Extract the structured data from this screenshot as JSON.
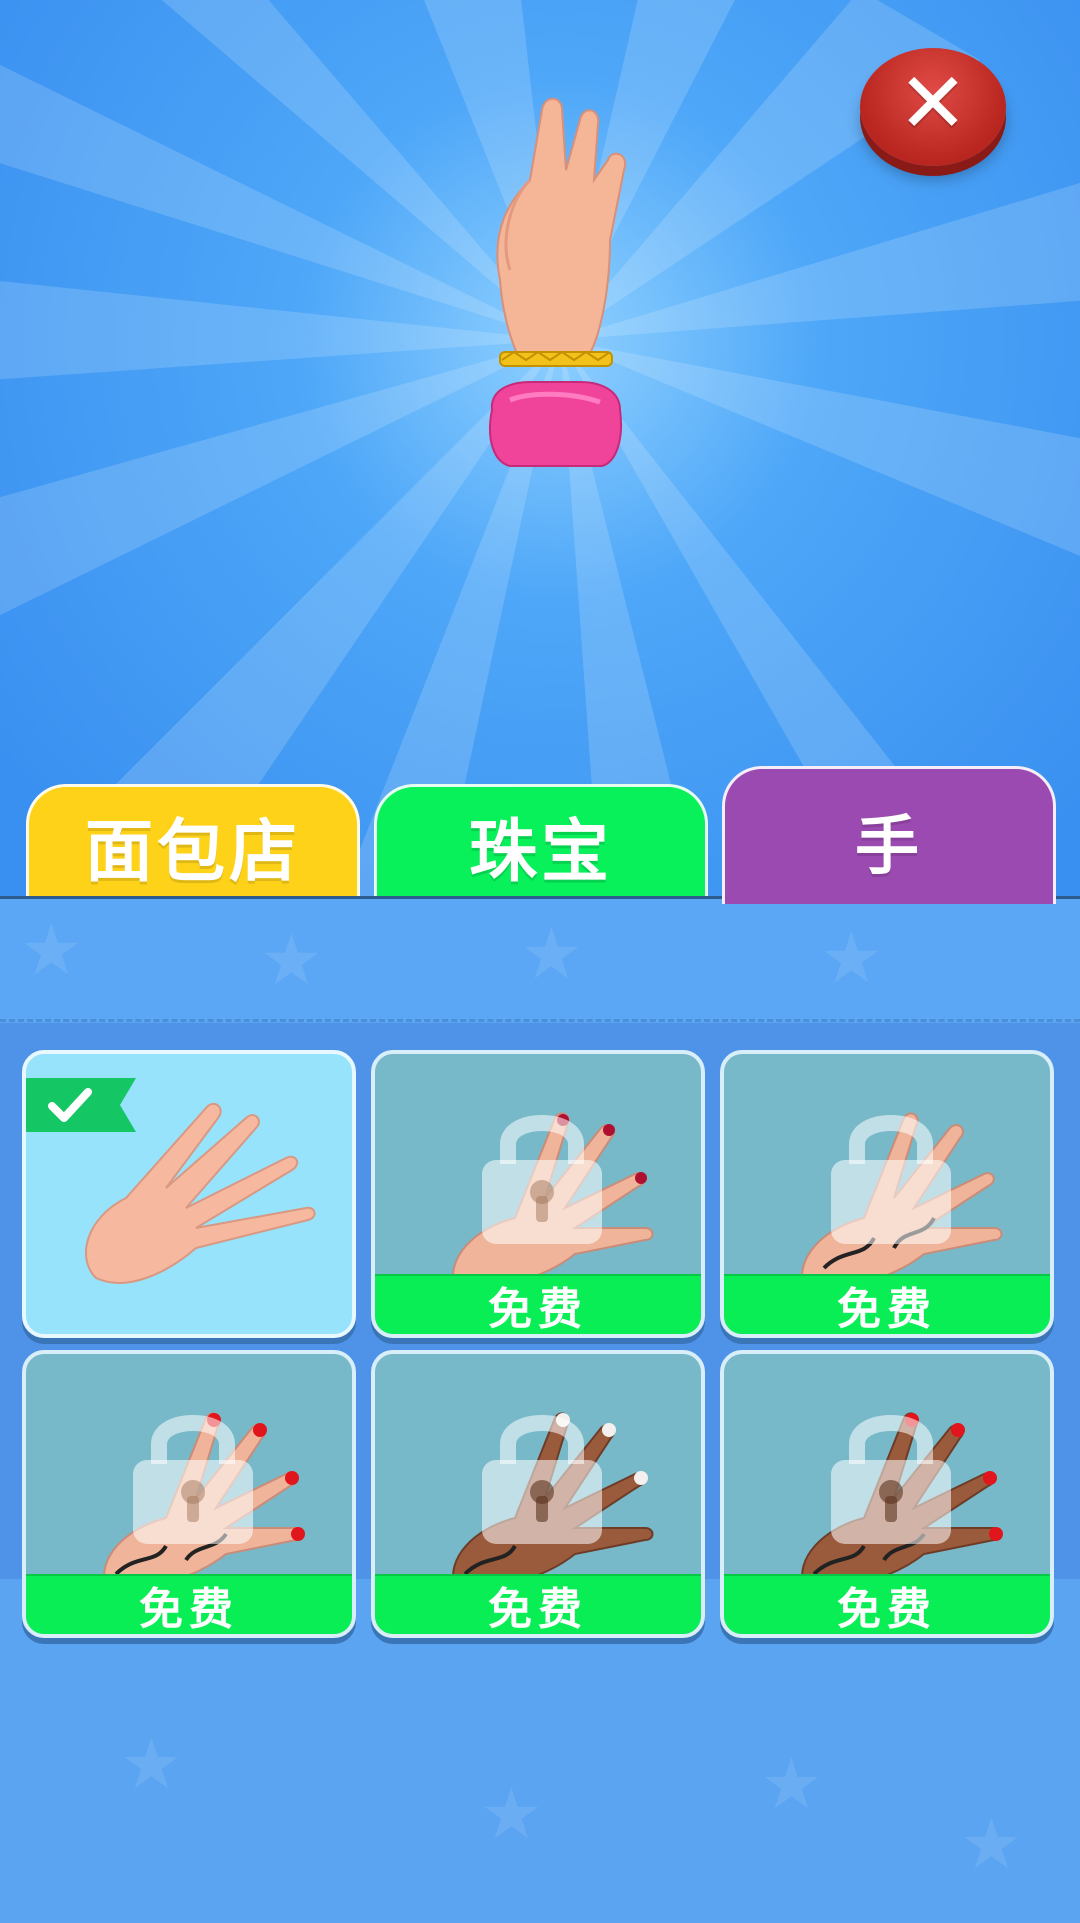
{
  "close_button": {
    "icon": "close-icon",
    "glyph": "✕"
  },
  "preview": {
    "subject": "hand-preview",
    "bracelet_color": "#f2c21a",
    "sleeve_color": "#f0439a"
  },
  "tabs": [
    {
      "label": "面包店",
      "color": "#ffd21a",
      "active": false
    },
    {
      "label": "珠宝",
      "color": "#08f05a",
      "active": false
    },
    {
      "label": "手",
      "color": "#9a4ab0",
      "active": true
    }
  ],
  "items": [
    {
      "id": "hand-1",
      "selected": true,
      "locked": false,
      "label": ""
    },
    {
      "id": "hand-2",
      "selected": false,
      "locked": true,
      "label": "免费"
    },
    {
      "id": "hand-3",
      "selected": false,
      "locked": true,
      "label": "免费"
    },
    {
      "id": "hand-4",
      "selected": false,
      "locked": true,
      "label": "免费"
    },
    {
      "id": "hand-5",
      "selected": false,
      "locked": true,
      "label": "免费"
    },
    {
      "id": "hand-6",
      "selected": false,
      "locked": true,
      "label": "免费"
    }
  ],
  "colors": {
    "background": "#3a92f0",
    "free_button": "#08ee54",
    "selected_card": "#97e3fb",
    "locked_card": "#77b8c9"
  }
}
